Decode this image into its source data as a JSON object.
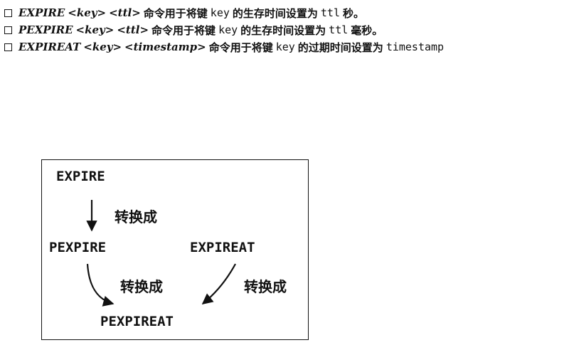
{
  "bullets": [
    {
      "cmd": "EXPIRE",
      "args": [
        "<key>",
        "<ttl>"
      ],
      "desc_a": "命令用于将键",
      "key_token": "key",
      "desc_b": "的生存时间设置为",
      "value_token": "ttl",
      "desc_c": "秒。"
    },
    {
      "cmd": "PEXPIRE",
      "args": [
        "<key>",
        "<ttl>"
      ],
      "desc_a": "命令用于将键",
      "key_token": "key",
      "desc_b": "的生存时间设置为",
      "value_token": "ttl",
      "desc_c": "毫秒。"
    },
    {
      "cmd": "EXPIREAT",
      "args": [
        "<key>",
        "<timestamp>"
      ],
      "desc_a": "命令用于将键",
      "key_token": "key",
      "desc_b": "的过期时间设置为",
      "value_token": "timestamp",
      "desc_c": ""
    }
  ],
  "diagram": {
    "nodes": {
      "expire": "EXPIRE",
      "pexpire": "PEXPIRE",
      "expireat": "EXPIREAT",
      "pexpireat": "PEXPIREAT"
    },
    "edge_labels": {
      "expire_to_pexpire": "转换成",
      "pexpire_to_pexpireat": "转换成",
      "expireat_to_pexpireat": "转换成"
    }
  }
}
